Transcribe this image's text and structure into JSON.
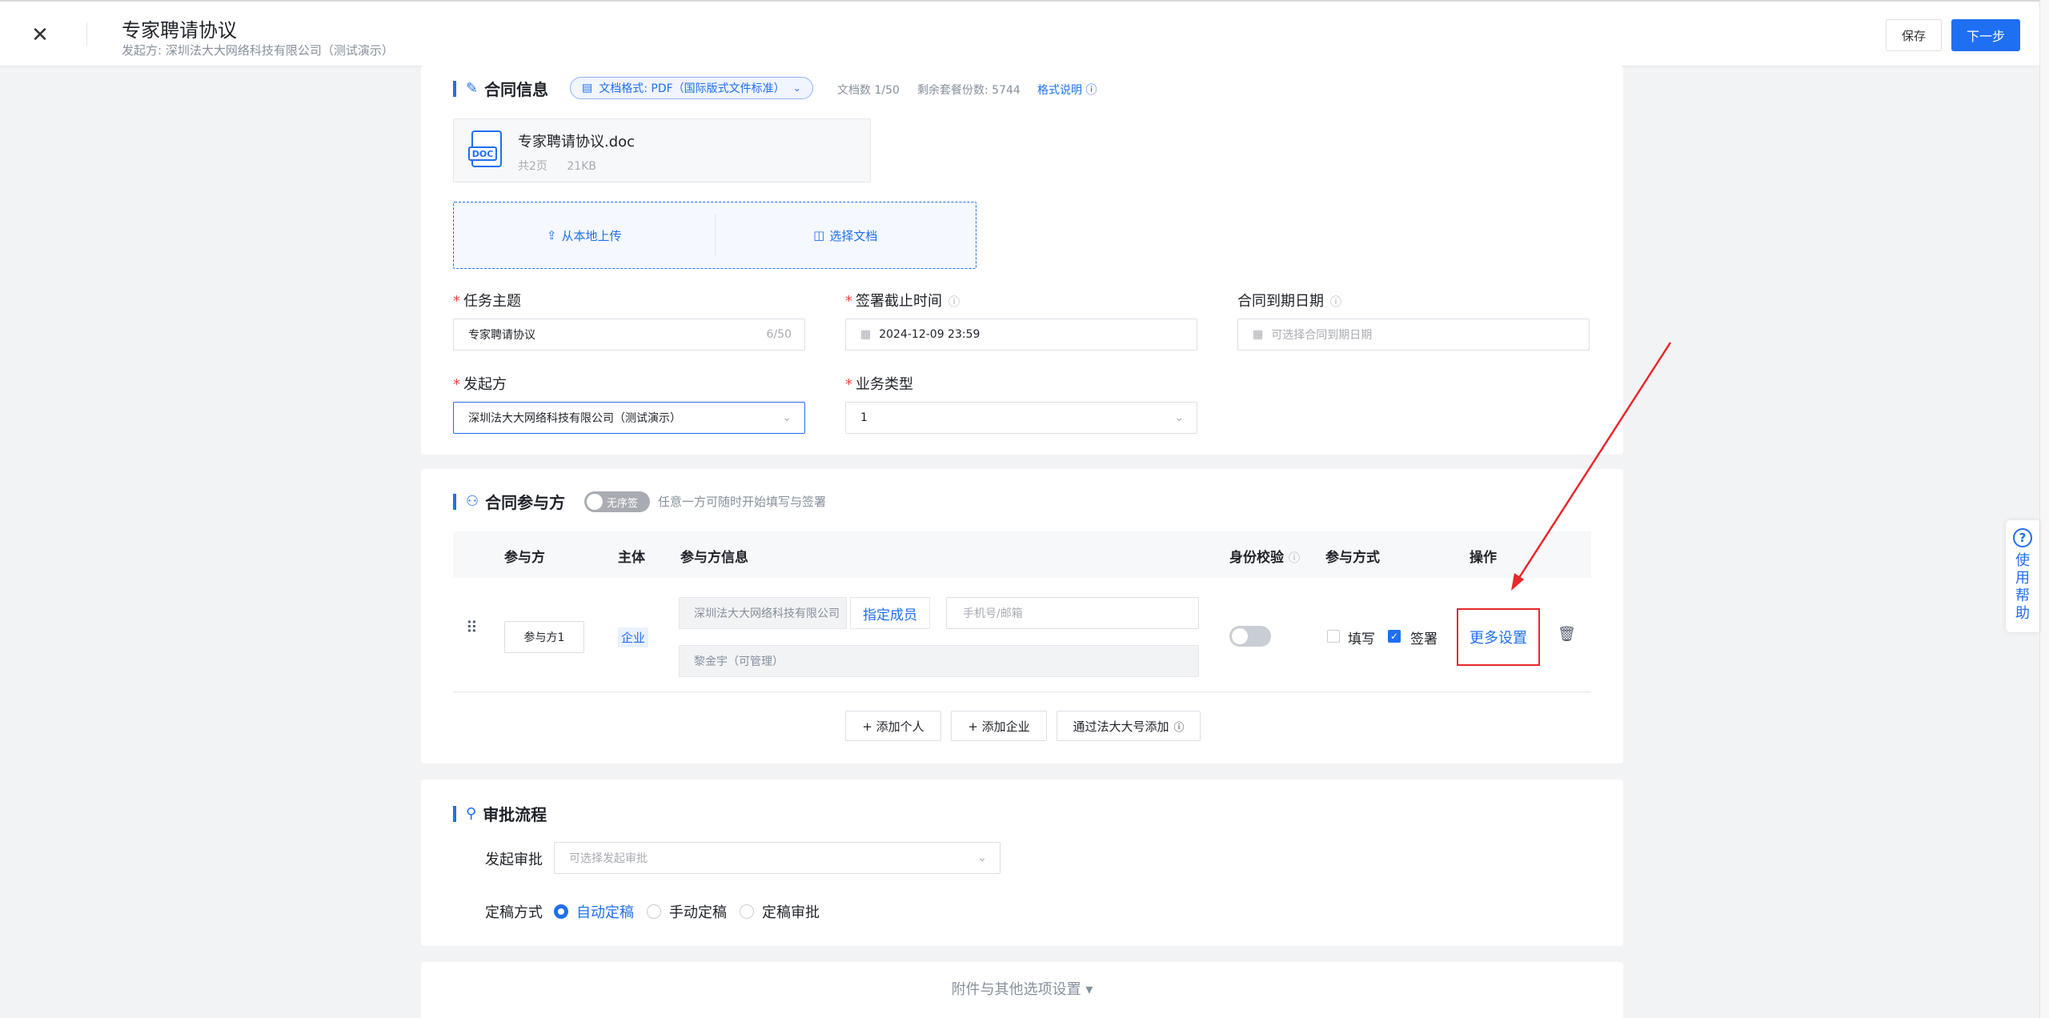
{
  "header": {
    "close_icon": "close-icon",
    "title": "专家聘请协议",
    "subtitle": "发起方: 深圳法大大网络科技有限公司（测试演示）",
    "save_label": "保存",
    "next_label": "下一步",
    "accent": "#1f6ff2"
  },
  "help": {
    "label": "使用帮助"
  },
  "contract_info": {
    "title": "合同信息",
    "format_label": "文档格式: PDF（国际版式文件标准）",
    "doc_count": "文档数 1/50",
    "remaining": "剩余套餐份数: 5744",
    "format_help": "格式说明",
    "file": {
      "name": "专家聘请协议.doc",
      "pages": "共2页",
      "size": "21KB",
      "icon_text": "DOC"
    },
    "upload_local": "从本地上传",
    "choose_doc": "选择文档",
    "task_subject_label": "任务主题",
    "task_subject_value": "专家聘请协议",
    "task_subject_count": "6/50",
    "deadline_label": "签署截止时间",
    "deadline_value": "2024-12-09 23:59",
    "expiry_label": "合同到期日期",
    "expiry_placeholder": "可选择合同到期日期",
    "initiator_label": "发起方",
    "initiator_value": "深圳法大大网络科技有限公司（测试演示）",
    "biz_type_label": "业务类型",
    "biz_type_value": "1"
  },
  "participants": {
    "title": "合同参与方",
    "toggle_label": "无序签",
    "toggle_desc": "任意一方可随时开始填写与签署",
    "headers": {
      "party": "参与方",
      "subject": "主体",
      "info": "参与方信息",
      "verify": "身份校验",
      "method": "参与方式",
      "ops": "操作"
    },
    "row": {
      "party": "参与方1",
      "subject": "企业",
      "company": "深圳法大大网络科技有限公司（测试演示）",
      "assign": "指定成员",
      "phone_placeholder": "手机号/邮箱",
      "member": "黎金宇（可管理）",
      "fill_label": "填写",
      "sign_label": "签署",
      "more_settings": "更多设置"
    },
    "add_person": "+ 添加个人",
    "add_company": "+ 添加企业",
    "add_by_fdd": "通过法大大号添加"
  },
  "approval": {
    "title": "审批流程",
    "initiate_label": "发起审批",
    "initiate_placeholder": "可选择发起审批",
    "finalize_label": "定稿方式",
    "options": [
      "自动定稿",
      "手动定稿",
      "定稿审批"
    ]
  },
  "more_options": {
    "label": "附件与其他选项设置 ▾"
  }
}
